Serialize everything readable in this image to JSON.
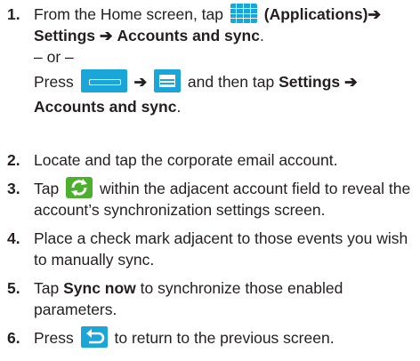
{
  "steps": [
    {
      "number": "1.",
      "parts": {
        "from_home": "From the Home screen, tap",
        "applications": "(Applications)",
        "arrow1": "➔",
        "settings": "Settings",
        "arrow2": "➔",
        "accounts_sync": "Accounts and sync",
        "period": ".",
        "or": "– or –",
        "press": "Press",
        "arrow3": "➔",
        "and_then_tap": "and then tap",
        "settings2": "Settings",
        "arrow4": "➔",
        "accounts_sync2": "Accounts and sync",
        "period2": "."
      }
    },
    {
      "number": "2.",
      "text": "Locate and tap the corporate email account."
    },
    {
      "number": "3.",
      "tap": "Tap",
      "rest_line1": "within the adjacent account field to reveal the",
      "line2": "account’s synchronization settings screen."
    },
    {
      "number": "4.",
      "line1": "Place a check mark adjacent to those events you wish",
      "line2": "to manually sync."
    },
    {
      "number": "5.",
      "tap": "Tap",
      "sync_now": "Sync now",
      "rest_line1": "to synchronize those enabled",
      "line2": "parameters."
    },
    {
      "number": "6.",
      "press": "Press",
      "rest": "to return to the previous screen."
    }
  ],
  "icons": {
    "applications": "apps-grid-icon",
    "home_key": "home-key-icon",
    "menu_key": "menu-key-icon",
    "sync": "sync-icon",
    "back_key": "back-key-icon"
  },
  "colors": {
    "text": "#231f20",
    "key_blue": "#1aa6d8",
    "sync_green": "#4caf2e"
  }
}
